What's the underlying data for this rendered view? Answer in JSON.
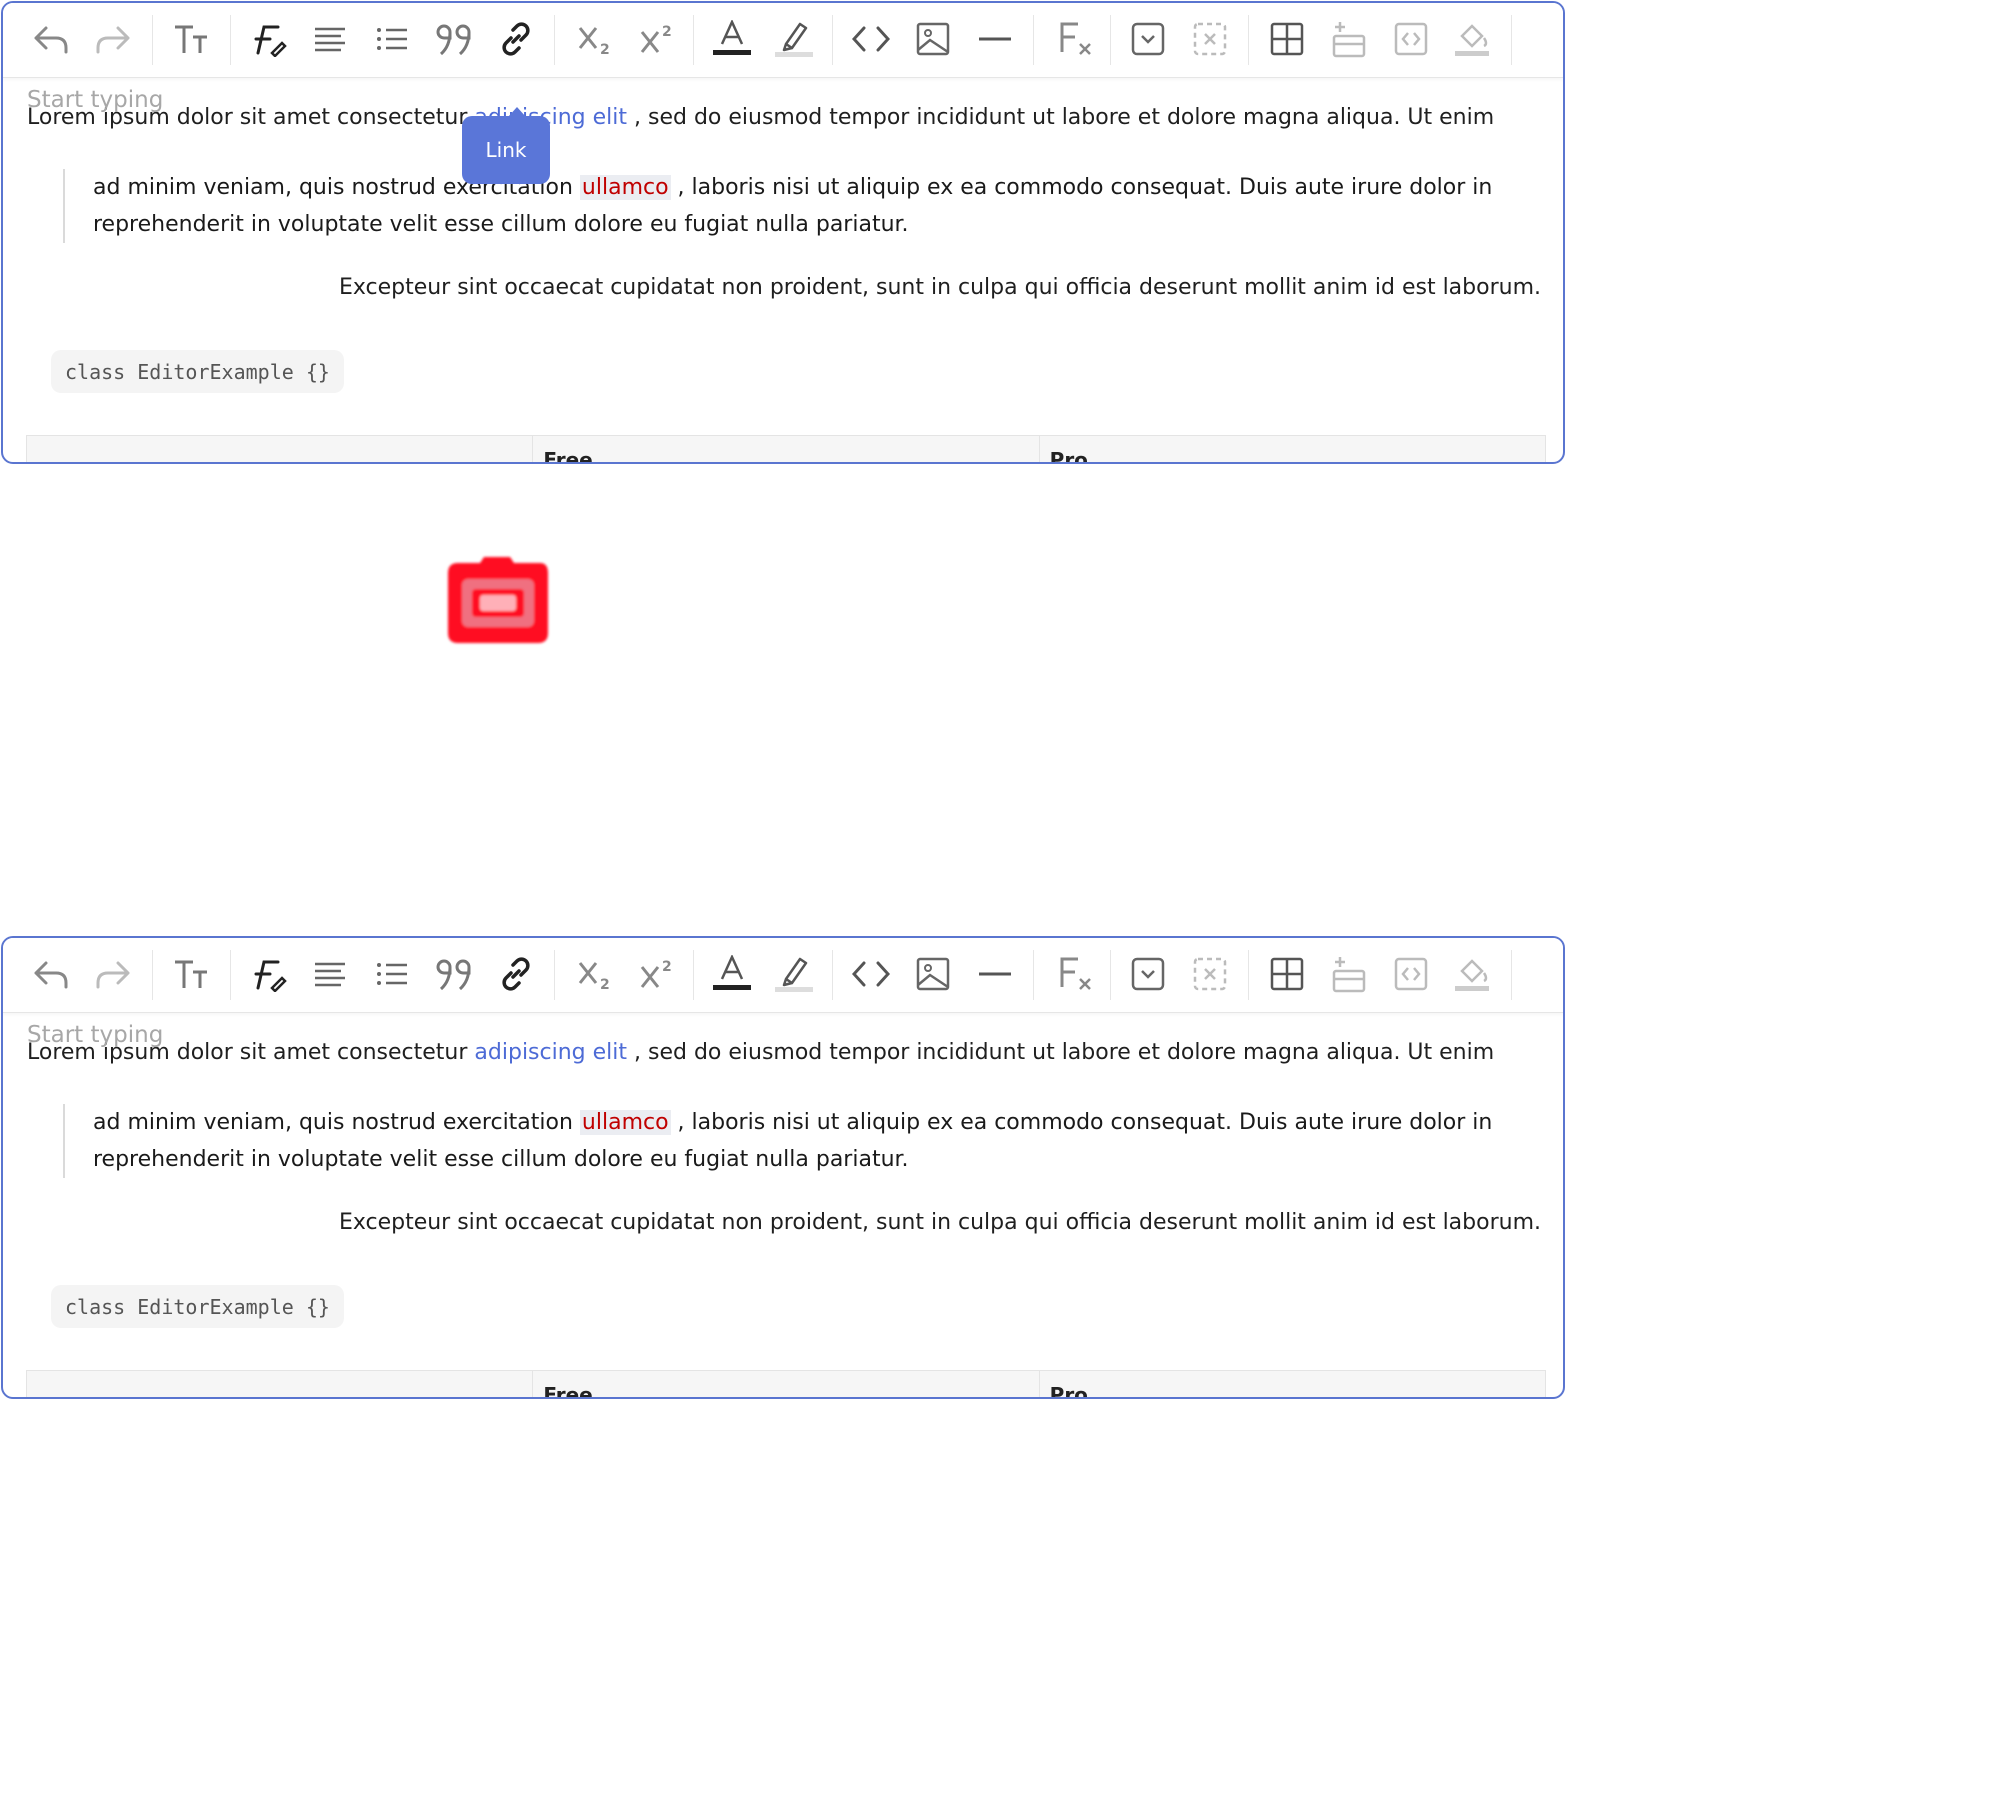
{
  "editor": {
    "placeholder": "Start typing",
    "paragraph1": {
      "before": "Lorem ipsum dolor sit amet consectetur ",
      "link": "adipiscing elit",
      "after": " , sed do eiusmod tempor incididunt ut labore et dolore magna aliqua. Ut enim"
    },
    "quote": {
      "before": "ad minim veniam, quis nostrud exercitation ",
      "highlight": "ullamco",
      "after": " , laboris nisi ut aliquip ex ea commodo consequat. Duis aute irure dolor in reprehenderit in voluptate velit esse cillum dolore eu fugiat nulla pariatur."
    },
    "right_paragraph": "Excepteur sint occaecat cupidatat non proident, sunt in culpa qui officia deserunt mollit anim id est laborum.",
    "code": "class EditorExample {}",
    "table_headers": [
      "",
      "Free",
      "Pro"
    ]
  },
  "tooltip": {
    "label": "Link"
  },
  "toolbar_icons": [
    "undo-icon",
    "redo-icon",
    "font-size-icon",
    "font-style-icon",
    "align-icon",
    "list-icon",
    "quote-icon",
    "link-icon",
    "subscript-icon",
    "superscript-icon",
    "text-color-icon",
    "highlight-icon",
    "code-icon",
    "image-icon",
    "horizontal-rule-icon",
    "clear-format-icon",
    "checkbox-icon",
    "delete-block-icon",
    "table-icon",
    "insert-row-icon",
    "embed-icon",
    "fill-icon"
  ],
  "colors": {
    "accent": "#5a75d0",
    "link": "#4d6bd6",
    "mark_text": "#c00000",
    "red_icon": "#ff0000"
  }
}
